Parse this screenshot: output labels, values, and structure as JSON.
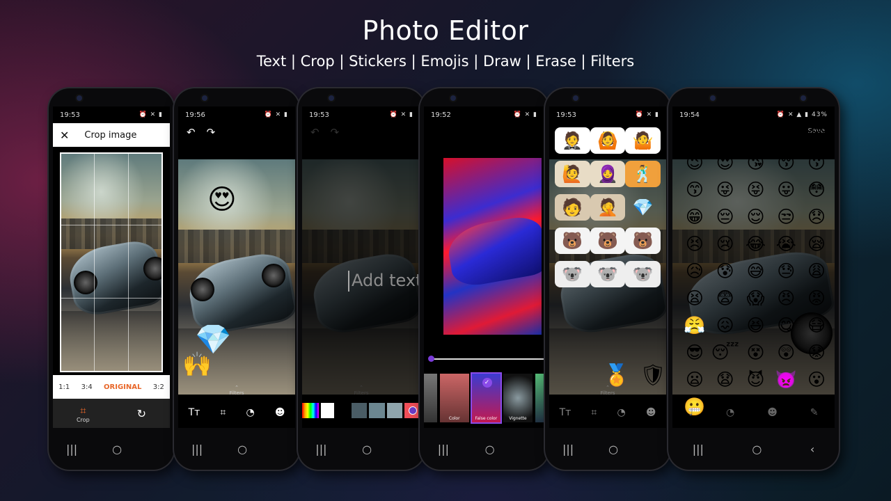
{
  "header": {
    "title": "Photo Editor",
    "subtitle": "Text | Crop | Stickers | Emojis | Draw | Erase | Filters"
  },
  "phones": [
    {
      "time": "19:53"
    },
    {
      "time": "19:56"
    },
    {
      "time": "19:53"
    },
    {
      "time": "19:52"
    },
    {
      "time": "19:53"
    },
    {
      "time": "19:54",
      "battery": "43%"
    }
  ],
  "crop": {
    "title": "Crop image",
    "ratios": [
      "1:1",
      "3:4",
      "ORIGINAL",
      "3:2"
    ],
    "selected_ratio": "ORIGINAL",
    "crop_label": "Crop",
    "accent": "#e8672a"
  },
  "editor": {
    "filters_label": "Filters",
    "add_text_placeholder": "Add text"
  },
  "filter_screen": {
    "labels": [
      "Color",
      "False color",
      "Vignette"
    ]
  },
  "emojis": {
    "save_label": "Save",
    "grid": [
      "😄",
      "😀",
      "😄",
      "😊",
      "😊",
      "😉",
      "😍",
      "😘",
      "😚",
      "😗",
      "😙",
      "😜",
      "😝",
      "😛",
      "😳",
      "😁",
      "😔",
      "😌",
      "😒",
      "😞",
      "😣",
      "😢",
      "😂",
      "😭",
      "😪",
      "😥",
      "😰",
      "😅",
      "😓",
      "😩",
      "😫",
      "😨",
      "😱",
      "😠",
      "😡",
      "😤",
      "😖",
      "😆",
      "😋",
      "😷",
      "😎",
      "😴",
      "😵",
      "😲",
      "😟",
      "😦",
      "😧",
      "😈",
      "👿",
      "😮",
      "😬",
      "😐",
      "😕",
      "😯",
      "😶"
    ]
  },
  "stickers": {
    "items": [
      "🤵",
      "🙆",
      "🤷",
      "🙋",
      "🧕",
      "🕺",
      "🧑",
      "🤦",
      "💎",
      "🐻",
      "🐻",
      "🐻",
      "🐨",
      "🐨",
      "🐨"
    ]
  },
  "nav": {
    "recents": "|||",
    "home": "○",
    "back": "‹"
  }
}
